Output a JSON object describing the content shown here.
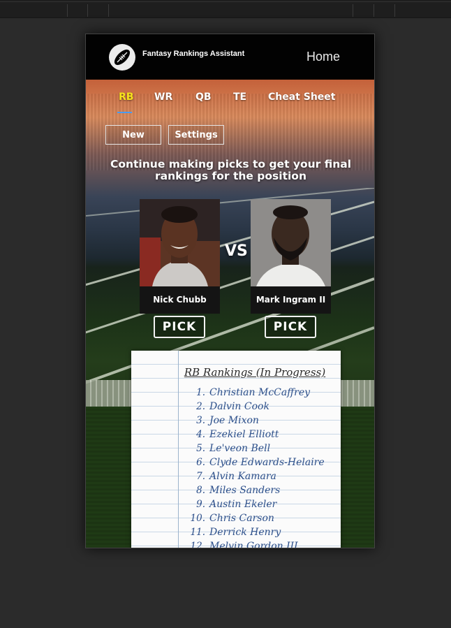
{
  "app": {
    "title": "Fantasy Rankings Assistant",
    "home_label": "Home"
  },
  "tabs": [
    {
      "label": "RB",
      "active": true
    },
    {
      "label": "WR",
      "active": false
    },
    {
      "label": "QB",
      "active": false
    },
    {
      "label": "TE",
      "active": false
    },
    {
      "label": "Cheat Sheet",
      "active": false
    }
  ],
  "controls": {
    "new_label": "New",
    "settings_label": "Settings"
  },
  "instruction": "Continue making picks to get your final rankings for the position",
  "matchup": {
    "left_player": "Nick Chubb",
    "vs_label": "VS",
    "right_player": "Mark Ingram II",
    "pick_label": "PICK"
  },
  "rankings": {
    "title": "RB Rankings (In Progress)",
    "items": [
      {
        "num": "1.",
        "name": "Christian McCaffrey"
      },
      {
        "num": "2.",
        "name": "Dalvin Cook"
      },
      {
        "num": "3.",
        "name": "Joe Mixon"
      },
      {
        "num": "4.",
        "name": "Ezekiel Elliott"
      },
      {
        "num": "5.",
        "name": "Le'veon Bell"
      },
      {
        "num": "6.",
        "name": "Clyde Edwards-Helaire"
      },
      {
        "num": "7.",
        "name": "Alvin Kamara"
      },
      {
        "num": "8.",
        "name": "Miles Sanders"
      },
      {
        "num": "9.",
        "name": "Austin Ekeler"
      },
      {
        "num": "10.",
        "name": "Chris Carson"
      },
      {
        "num": "11.",
        "name": "Derrick Henry"
      },
      {
        "num": "12.",
        "name": "Melvin Gordon III"
      }
    ]
  },
  "colors": {
    "active_tab": "#f5e21b",
    "tab_underline": "#4a9cf0",
    "header_bg": "#020202",
    "ink": "#2c4f8a"
  },
  "icons": {
    "logo": "football-icon"
  }
}
